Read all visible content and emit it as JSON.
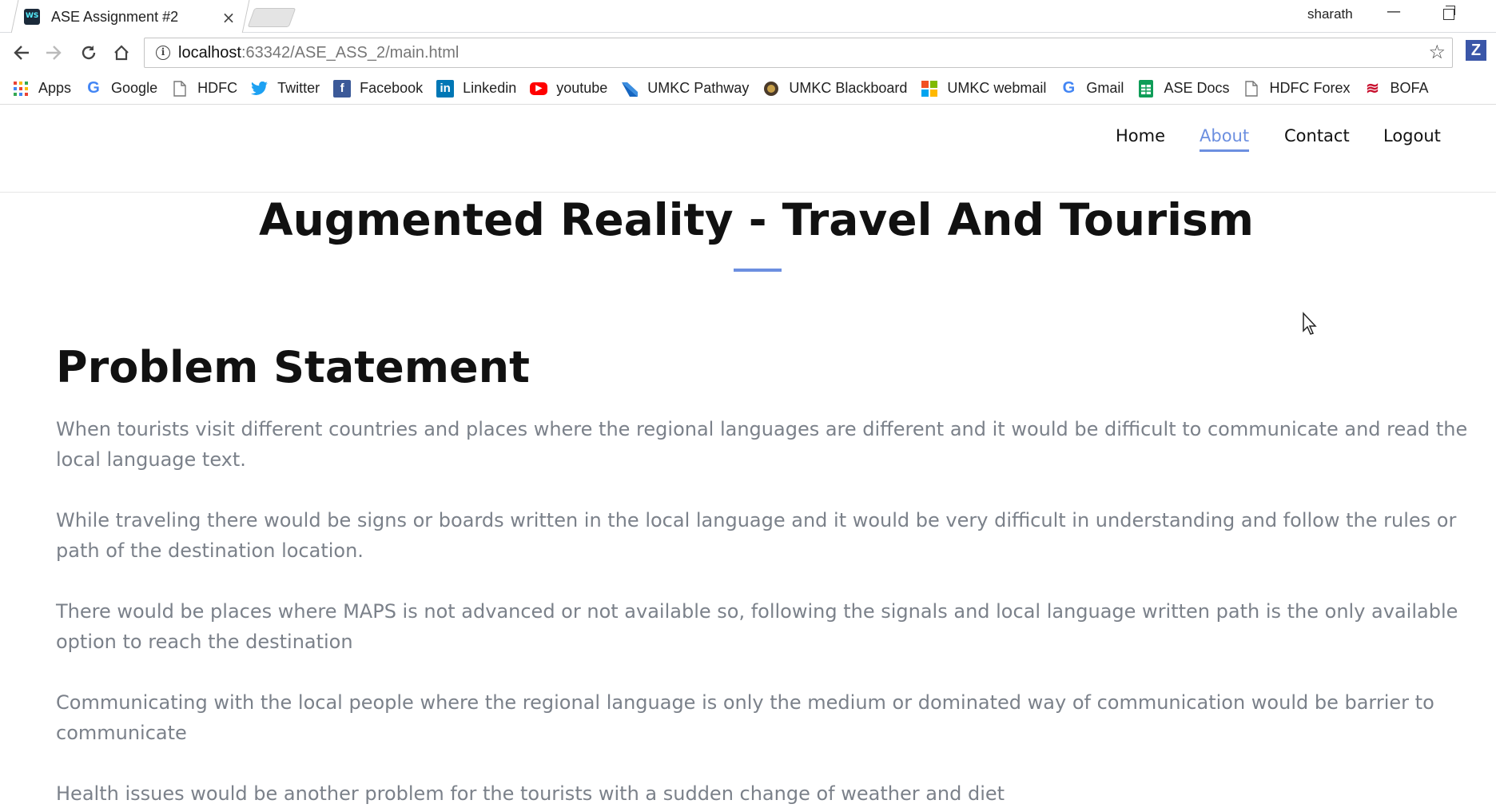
{
  "browser": {
    "tab": {
      "title": "ASE Assignment #2",
      "close": "×"
    },
    "profile": "sharath",
    "window": {
      "minimize": "—"
    },
    "url": {
      "host": "localhost",
      "rest": ":63342/ASE_ASS_2/main.html"
    },
    "extension_letter": "Z",
    "bookmarks": [
      {
        "label": "Apps",
        "icon": "apps-grid-icon",
        "color": "#ea4335"
      },
      {
        "label": "Google",
        "icon": "google-icon",
        "color": "#4285f4"
      },
      {
        "label": "HDFC",
        "icon": "page-icon",
        "color": "#888888"
      },
      {
        "label": "Twitter",
        "icon": "twitter-icon",
        "color": "#1da1f2"
      },
      {
        "label": "Facebook",
        "icon": "facebook-icon",
        "color": "#3b5998"
      },
      {
        "label": "Linkedin",
        "icon": "linkedin-icon",
        "color": "#0077b5"
      },
      {
        "label": "youtube",
        "icon": "youtube-icon",
        "color": "#ff0000"
      },
      {
        "label": "UMKC Pathway",
        "icon": "umkc-pathway-icon",
        "color": "#1565c0"
      },
      {
        "label": "UMKC Blackboard",
        "icon": "umkc-seal-icon",
        "color": "#4a3a2a"
      },
      {
        "label": "UMKC webmail",
        "icon": "microsoft-icon",
        "color": "#f25022"
      },
      {
        "label": "Gmail",
        "icon": "google-icon",
        "color": "#4285f4"
      },
      {
        "label": "ASE Docs",
        "icon": "sheets-icon",
        "color": "#0f9d58"
      },
      {
        "label": "HDFC Forex",
        "icon": "page-icon",
        "color": "#888888"
      },
      {
        "label": "BOFA",
        "icon": "bofa-icon",
        "color": "#c8102e"
      }
    ]
  },
  "site": {
    "nav": [
      {
        "label": "Home",
        "active": false
      },
      {
        "label": "About",
        "active": true
      },
      {
        "label": "Contact",
        "active": false
      },
      {
        "label": "Logout",
        "active": false
      }
    ],
    "accent": "#6c8fe0",
    "hero_title": "Augmented Reality - Travel And Tourism",
    "section_title": "Problem Statement",
    "paragraphs": [
      "When tourists visit different countries and places where the regional languages are different and it would be difficult to communicate and read the local language text.",
      "While traveling there would be signs or boards written in the local language and it would be very difficult in understanding and follow the rules or path of the destination location.",
      "There would be places where MAPS is not advanced or not available so, following the signals and local language written path is the only available option to reach the destination",
      "Communicating with the local people where the regional language is only the medium or dominated way of communication would be barrier to communicate",
      "Health issues would be another problem for the tourists with a sudden change of weather and diet"
    ]
  }
}
